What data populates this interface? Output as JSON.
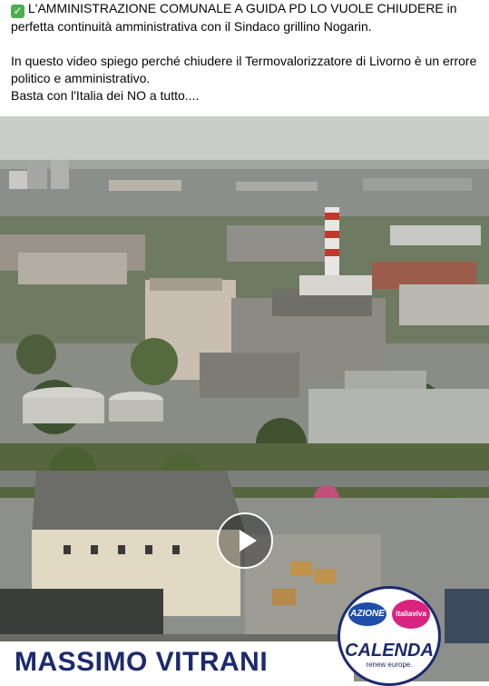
{
  "post": {
    "check_icon": "check-mark-button-emoji",
    "line1": "L'AMMINISTRAZIONE COMUNALE A GUIDA PD LO VUOLE CHIUDERE in perfetta continuità amministrativa con il Sindaco grillino Nogarin.",
    "line2": "In questo video spiego perché chiudere il Termovalorizzatore di Livorno è un errore politico e amministrativo.",
    "line3": "Basta con l'Italia dei NO a tutto...."
  },
  "video": {
    "play_icon": "play-icon",
    "name_banner": "MASSIMO VITRANI",
    "logo": {
      "azione": "AZIONE",
      "italiaviva": "italiaviva",
      "calenda": "CALENDA",
      "renew": "renew europe."
    }
  },
  "colors": {
    "banner_text": "#1c2a6e",
    "check": "#4caf50",
    "azione": "#1f4ea8",
    "italiaviva": "#d8247f"
  }
}
